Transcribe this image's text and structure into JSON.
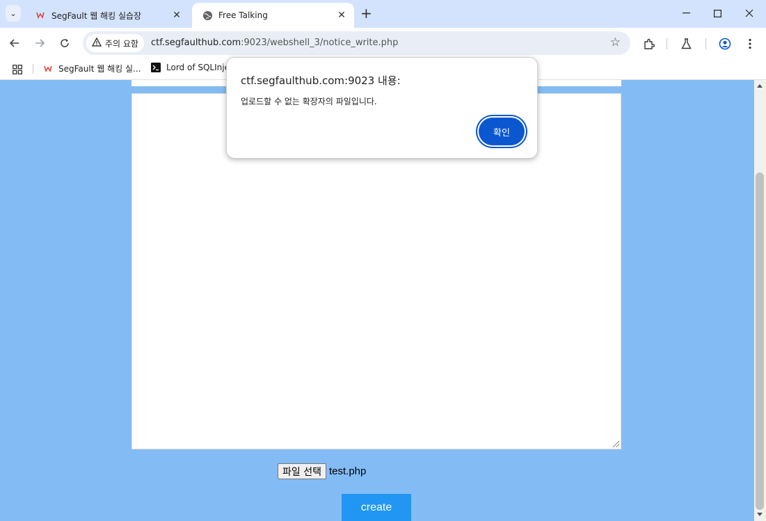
{
  "browser": {
    "tabs": [
      {
        "title": "SegFault 웹 해킹 실습장",
        "active": false
      },
      {
        "title": "Free Talking",
        "active": true
      }
    ],
    "security_chip": "주의 요함",
    "url": {
      "host": "ctf.segfaulthub.com",
      "rest": ":9023/webshell_3/notice_write.php"
    },
    "bookmarks": [
      {
        "label": "SegFault 웹 해킹 실..."
      },
      {
        "label": "Lord of SQLInje"
      }
    ]
  },
  "page": {
    "file_button_label": "파일 선택",
    "file_name": "test.php",
    "create_label": "create",
    "background_color": "#83bcf5",
    "button_color": "#2196f3"
  },
  "dialog": {
    "title": "ctf.segfaulthub.com:9023 내용:",
    "message": "업로드할 수 없는 확장자의 파일입니다.",
    "ok_label": "확인",
    "ok_color": "#0b57d0"
  }
}
